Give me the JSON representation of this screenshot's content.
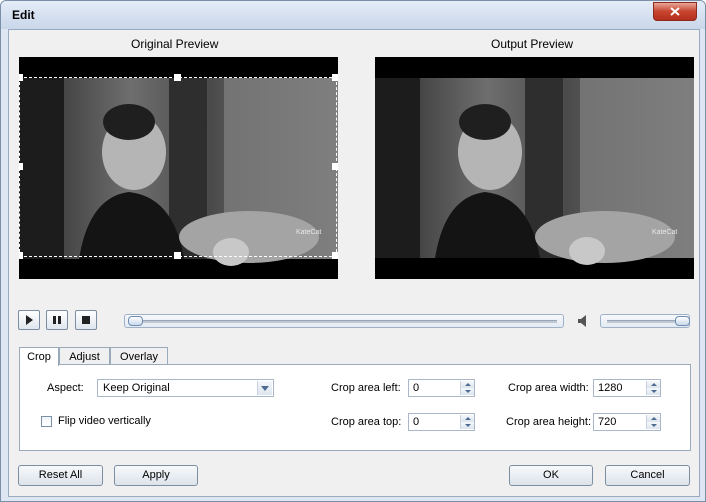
{
  "window": {
    "title": "Edit",
    "close_icon": "close-icon"
  },
  "previews": {
    "original_label": "Original Preview",
    "output_label": "Output Preview",
    "watermark": "KateCat"
  },
  "playback": {
    "play_icon": "play-icon",
    "pause_icon": "pause-icon",
    "stop_icon": "stop-icon",
    "position": 0,
    "volume_icon": "speaker-icon",
    "volume": 1.0
  },
  "tabs": [
    {
      "label": "Crop",
      "active": true
    },
    {
      "label": "Adjust",
      "active": false
    },
    {
      "label": "Overlay",
      "active": false
    }
  ],
  "crop": {
    "aspect_label": "Aspect:",
    "aspect_value": "Keep Original",
    "flip_label": "Flip video vertically",
    "flip_checked": false,
    "left_label": "Crop area left:",
    "left_value": "0",
    "top_label": "Crop area top:",
    "top_value": "0",
    "width_label": "Crop area width:",
    "width_value": "1280",
    "height_label": "Crop area height:",
    "height_value": "720"
  },
  "buttons": {
    "reset_all": "Reset All",
    "apply": "Apply",
    "ok": "OK",
    "cancel": "Cancel"
  },
  "colors": {
    "title_bar": "#c9d7ea",
    "close_button": "#c7442f",
    "dialog_bg": "#f0f0f0"
  }
}
